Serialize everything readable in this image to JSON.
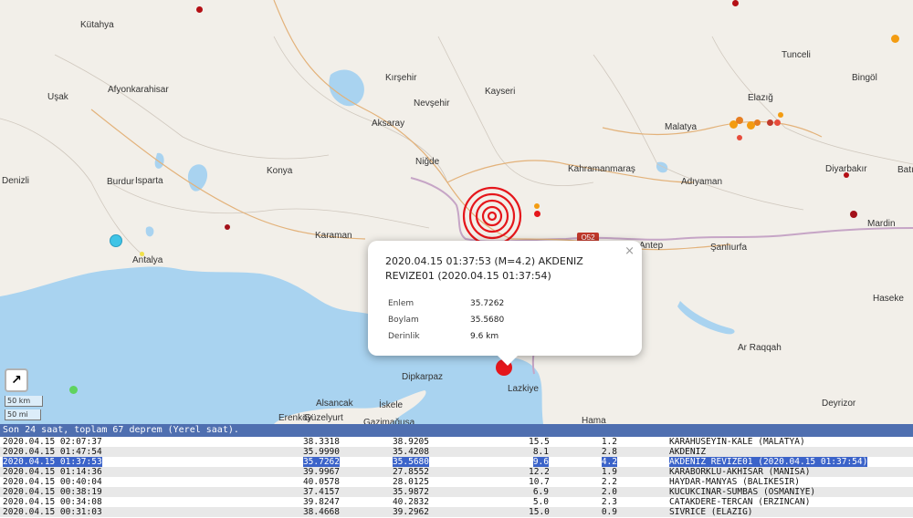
{
  "map": {
    "cities": [
      {
        "name": "Kütahya"
      },
      {
        "name": "Kırşehir"
      },
      {
        "name": "Tunceli"
      },
      {
        "name": "Bingöl"
      },
      {
        "name": "Uşak"
      },
      {
        "name": "Afyonkarahisar"
      },
      {
        "name": "Nevşehir"
      },
      {
        "name": "Kayseri"
      },
      {
        "name": "Elazığ"
      },
      {
        "name": "Aksaray"
      },
      {
        "name": "Malatya"
      },
      {
        "name": "Niğde"
      },
      {
        "name": "Diyarbakır"
      },
      {
        "name": "Batı"
      },
      {
        "name": "Denizli"
      },
      {
        "name": "Burdur"
      },
      {
        "name": "Isparta"
      },
      {
        "name": "Konya"
      },
      {
        "name": "Kahramanmaraş"
      },
      {
        "name": "Adıyaman"
      },
      {
        "name": "Mardin"
      },
      {
        "name": "Karaman"
      },
      {
        "name": "Şanlıurfa"
      },
      {
        "name": "Antalya"
      },
      {
        "name": "Haseke"
      },
      {
        "name": "Ar Raqqah"
      },
      {
        "name": "Dipkarpaz"
      },
      {
        "name": "Lazkiye"
      },
      {
        "name": "Alsancak"
      },
      {
        "name": "İskele"
      },
      {
        "name": "Deyrizor"
      },
      {
        "name": "Erenköy"
      },
      {
        "name": "Güzelyurt"
      },
      {
        "name": "Gazimağusa"
      },
      {
        "name": "Hama"
      },
      {
        "name": "Antep"
      }
    ],
    "road_shield": "O52",
    "road_shield_color": "#c0392b",
    "scale_km": "50 km",
    "scale_mi": "50 mi",
    "popup": {
      "title": "2020.04.15 01:37:53 (M=4.2) AKDENIZ REVIZE01 (2020.04.15 01:37:54)",
      "close": "×",
      "rows": [
        {
          "label": "Enlem",
          "value": "35.7262"
        },
        {
          "label": "Boylam",
          "value": "35.5680"
        },
        {
          "label": "Derinlik",
          "value": "9.6 km"
        }
      ]
    },
    "colors": {
      "sea": "#a9d3f0",
      "land": "#f2efe9",
      "epicenter": "#e5161b",
      "recent": "#b40f15"
    }
  },
  "panel": {
    "summary": "Son 24 saat, toplam 67 deprem (Yerel saat).",
    "selected_index": 2,
    "rows": [
      {
        "time": "2020.04.15 02:07:37",
        "lat": "38.3318",
        "lon": "38.9205",
        "depth": "15.5",
        "mag": "1.2",
        "place": "KARAHUSEYIN-KALE (MALATYA)"
      },
      {
        "time": "2020.04.15 01:47:54",
        "lat": "35.9990",
        "lon": "35.4208",
        "depth": "8.1",
        "mag": "2.8",
        "place": "AKDENIZ"
      },
      {
        "time": "2020.04.15 01:37:53",
        "lat": "35.7262",
        "lon": "35.5680",
        "depth": "9.6",
        "mag": "4.2",
        "place": "AKDENIZ REVIZE01 (2020.04.15 01:37:54)"
      },
      {
        "time": "2020.04.15 01:14:36",
        "lat": "39.9967",
        "lon": "27.8552",
        "depth": "12.2",
        "mag": "1.9",
        "place": "KARABORKLU-AKHISAR (MANISA)"
      },
      {
        "time": "2020.04.15 00:40:04",
        "lat": "40.0578",
        "lon": "28.0125",
        "depth": "10.7",
        "mag": "2.2",
        "place": "HAYDAR-MANYAS (BALIKESIR)"
      },
      {
        "time": "2020.04.15 00:38:19",
        "lat": "37.4157",
        "lon": "35.9872",
        "depth": "6.9",
        "mag": "2.0",
        "place": "KUCUKCINAR-SUMBAS (OSMANIYE)"
      },
      {
        "time": "2020.04.15 00:34:08",
        "lat": "39.8247",
        "lon": "40.2832",
        "depth": "5.0",
        "mag": "2.3",
        "place": "CATAKDERE-TERCAN (ERZINCAN)"
      },
      {
        "time": "2020.04.15 00:31:03",
        "lat": "38.4668",
        "lon": "39.2962",
        "depth": "15.0",
        "mag": "0.9",
        "place": "SIVRICE (ELAZIG)"
      }
    ]
  }
}
